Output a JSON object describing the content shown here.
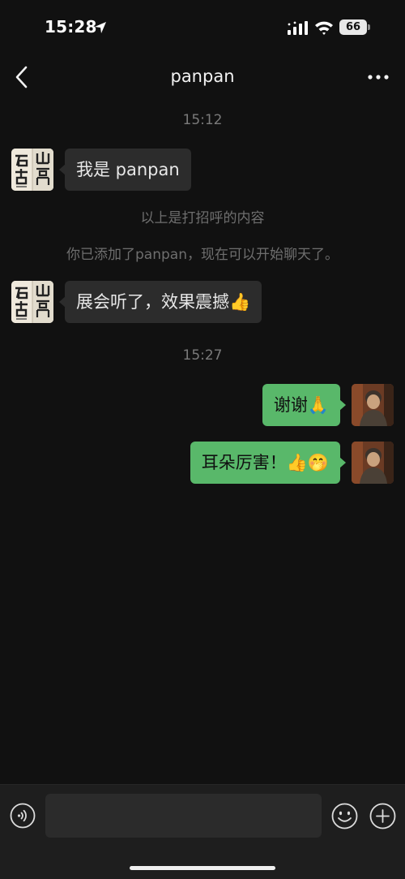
{
  "status": {
    "time": "15:28",
    "battery": "66",
    "location_icon": "location-arrow-icon",
    "signal_icon": "cellular-signal-icon",
    "wifi_icon": "wifi-icon"
  },
  "nav": {
    "title": "panpan",
    "back_icon": "chevron-left-icon",
    "more_icon": "more-dots-icon"
  },
  "chat": {
    "time_1": "15:12",
    "msg_1": "我是 panpan",
    "sys_1": "以上是打招呼的内容",
    "sys_2": "你已添加了panpan，现在可以开始聊天了。",
    "msg_2": "展会听了，效果震撼👍",
    "time_2": "15:27",
    "msg_3": "谢谢🙏",
    "msg_4": "耳朵厉害！👍🤭"
  },
  "input_bar": {
    "input_value": "",
    "voice_icon": "voice-icon",
    "emoji_icon": "emoji-icon",
    "plus_icon": "plus-icon"
  },
  "colors": {
    "background": "#111111",
    "incoming_bubble": "#2c2c2c",
    "outgoing_bubble": "#59b86a",
    "input_bar": "#1e1e1e"
  }
}
